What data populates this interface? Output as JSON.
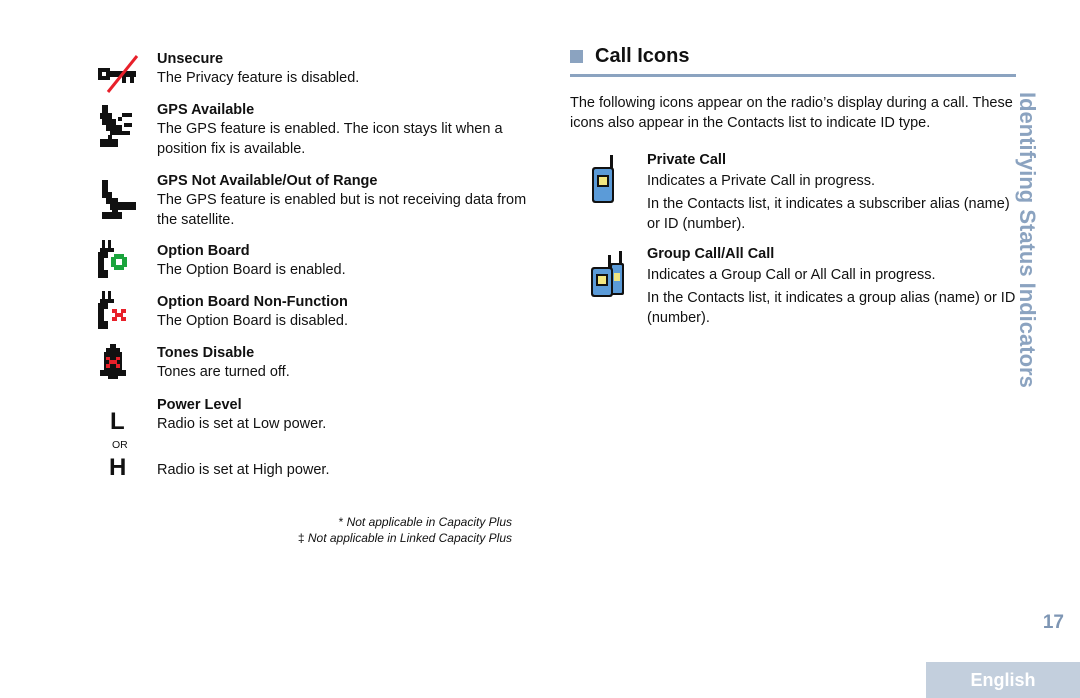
{
  "left_column": {
    "items": [
      {
        "icon": "unsecure-key-icon",
        "title": "Unsecure",
        "desc": [
          "The Privacy feature is disabled."
        ]
      },
      {
        "icon": "gps-available-icon",
        "title": "GPS Available",
        "desc": [
          "The GPS feature is enabled. The icon stays lit when a position fix is available."
        ]
      },
      {
        "icon": "gps-not-available-icon",
        "title": "GPS Not Available/Out of Range",
        "desc": [
          "The GPS feature is enabled but is not receiving data from the satellite."
        ]
      },
      {
        "icon": "option-board-icon",
        "title": "Option Board",
        "desc": [
          "The Option Board is enabled."
        ]
      },
      {
        "icon": "option-board-non-function-icon",
        "title": "Option Board Non-Function",
        "desc": [
          "The Option Board is disabled."
        ]
      },
      {
        "icon": "tones-disable-icon",
        "title": "Tones Disable",
        "desc": [
          "Tones are turned off."
        ]
      },
      {
        "icon": "power-level-icon",
        "title": "Power Level",
        "desc": [
          "Radio is set at Low power.",
          "Radio is set at High power."
        ],
        "low_glyph": "L",
        "or_label": "OR",
        "high_glyph": "H"
      }
    ],
    "footnotes": [
      {
        "mark": "*",
        "text": "Not applicable in Capacity Plus"
      },
      {
        "mark": "‡",
        "text": "Not applicable in Linked Capacity Plus"
      }
    ]
  },
  "right_column": {
    "section_title": "Call Icons",
    "intro": "The following icons appear on the radio’s display during a call. These icons also appear in the Contacts list to indicate ID type.",
    "items": [
      {
        "icon": "private-call-icon",
        "title": "Private Call",
        "lines": [
          "Indicates a Private Call in progress.",
          "In the Contacts list, it indicates a subscriber alias (name) or ID (number)."
        ]
      },
      {
        "icon": "group-call-icon",
        "title": "Group Call/All Call",
        "lines": [
          "Indicates a Group Call or All Call in progress.",
          "In the Contacts list, it indicates a group alias (name) or ID (number)."
        ]
      }
    ]
  },
  "side_title": "Identifying Status Indicators",
  "page_number": "17",
  "language_tab": "English",
  "colors": {
    "accent": "#8ba3c0",
    "tab_bg": "#c3cfdd",
    "green": "#1aa43c",
    "red": "#e8202a",
    "radio_blue": "#5b9bd8",
    "radio_screen": "#f2e680"
  }
}
